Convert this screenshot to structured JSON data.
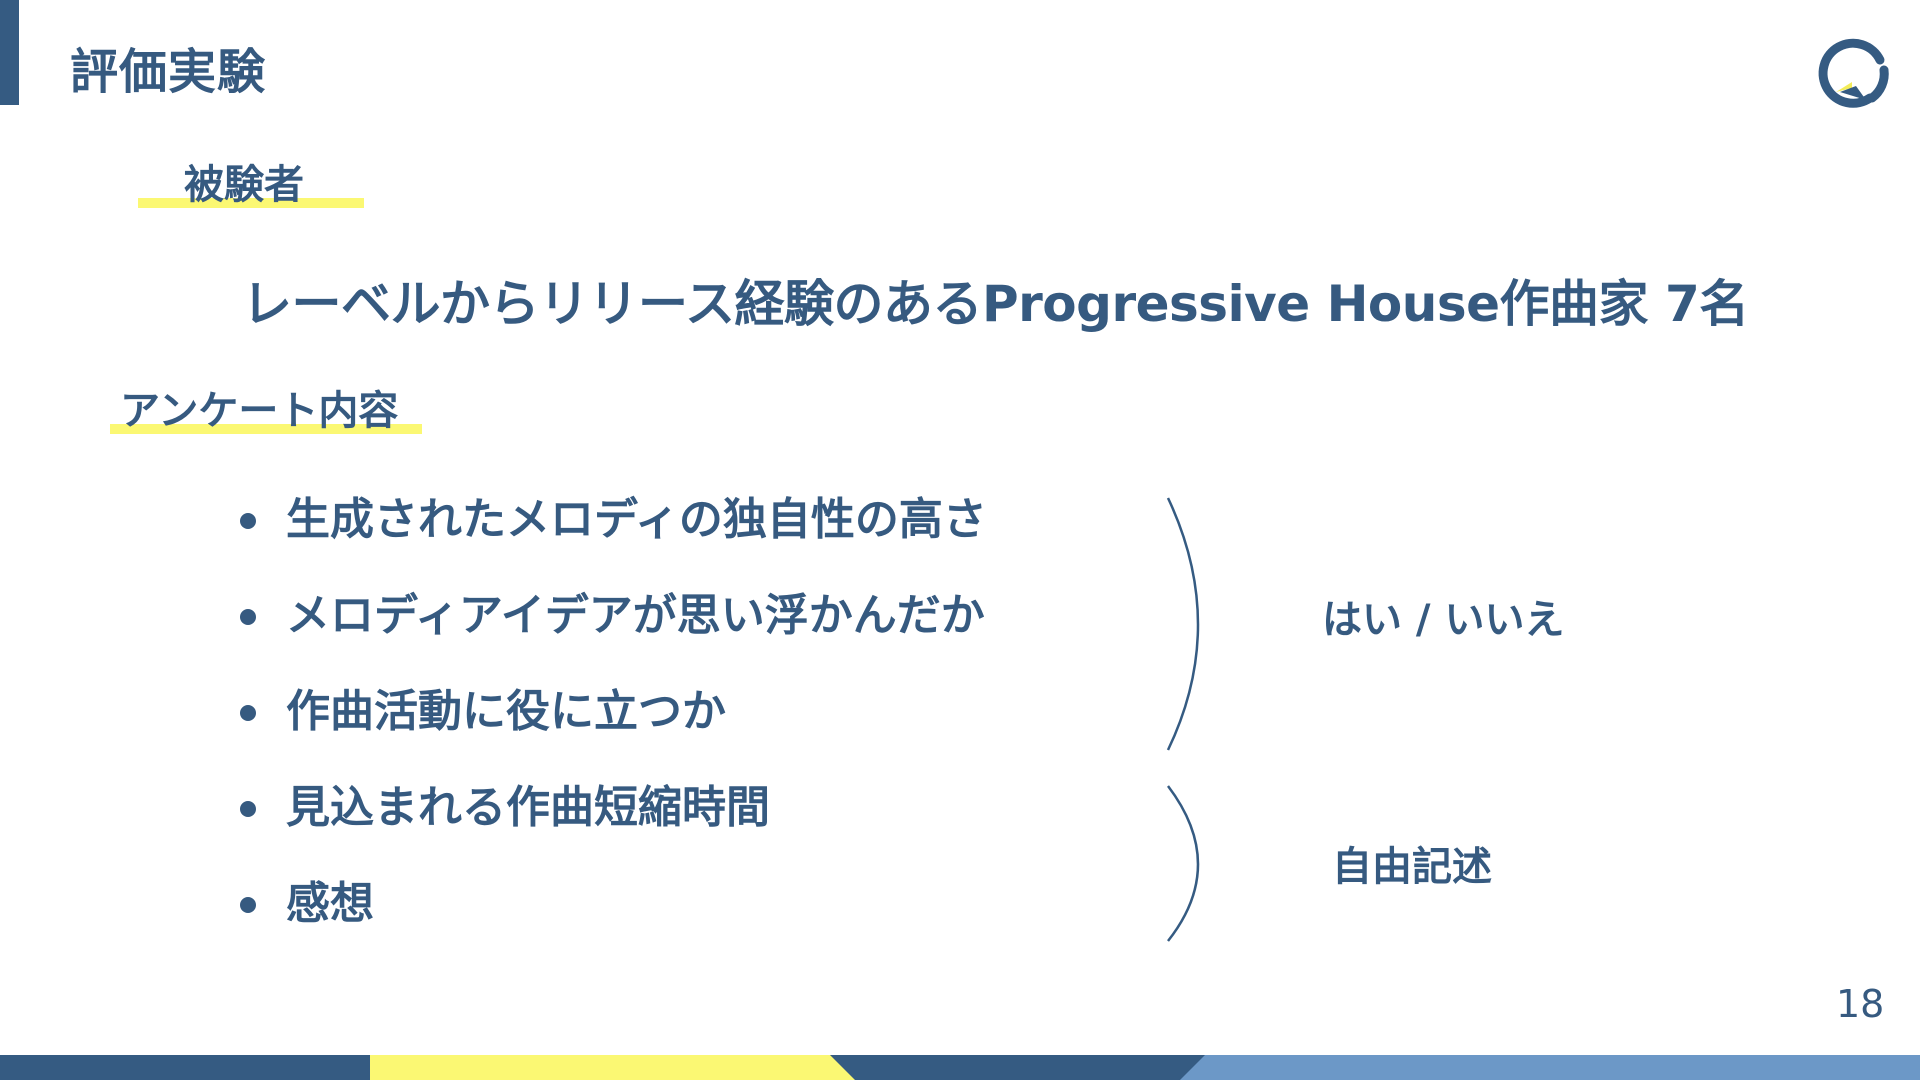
{
  "slide": {
    "title": "評価実験",
    "page_number": "18"
  },
  "subjects": {
    "heading": "被験者",
    "description": "レーベルからリリース経験のあるProgressive House作曲家 7名"
  },
  "survey": {
    "heading": "アンケート内容",
    "items": [
      "生成されたメロディの独自性の高さ",
      "メロディアイデアが思い浮かんだか",
      "作曲活動に役に立つか",
      "見込まれる作曲短縮時間",
      "感想"
    ],
    "groups": [
      {
        "answer": "はい / いいえ"
      },
      {
        "answer": "自由記述"
      }
    ]
  },
  "colors": {
    "navy": "#355b82",
    "text": "#365a80",
    "highlight_yellow": "#fbf873",
    "light_blue": "#6c98c7",
    "logo_accent": "#f3ec5a"
  }
}
